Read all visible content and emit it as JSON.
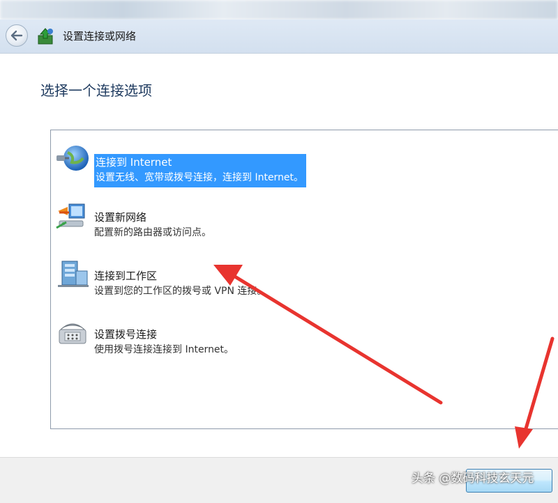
{
  "window": {
    "nav_title": "设置连接或网络"
  },
  "main": {
    "heading": "选择一个连接选项",
    "options": [
      {
        "title": "连接到 Internet",
        "description": "设置无线、宽带或拨号连接，连接到 Internet。",
        "icon": "globe-icon",
        "selected": true
      },
      {
        "title": "设置新网络",
        "description": "配置新的路由器或访问点。",
        "icon": "router-icon",
        "selected": false
      },
      {
        "title": "连接到工作区",
        "description": "设置到您的工作区的拨号或 VPN 连接。",
        "icon": "workplace-icon",
        "selected": false
      },
      {
        "title": "设置拨号连接",
        "description": "使用拨号连接连接到 Internet。",
        "icon": "dialup-phone-icon",
        "selected": false
      }
    ]
  },
  "footer": {
    "next_button_label": ""
  },
  "watermark": "头条 @数码科技玄天元",
  "colors": {
    "selection": "#3399ff",
    "heading": "#1e3a5f",
    "annotation_arrow": "#e8342f"
  }
}
